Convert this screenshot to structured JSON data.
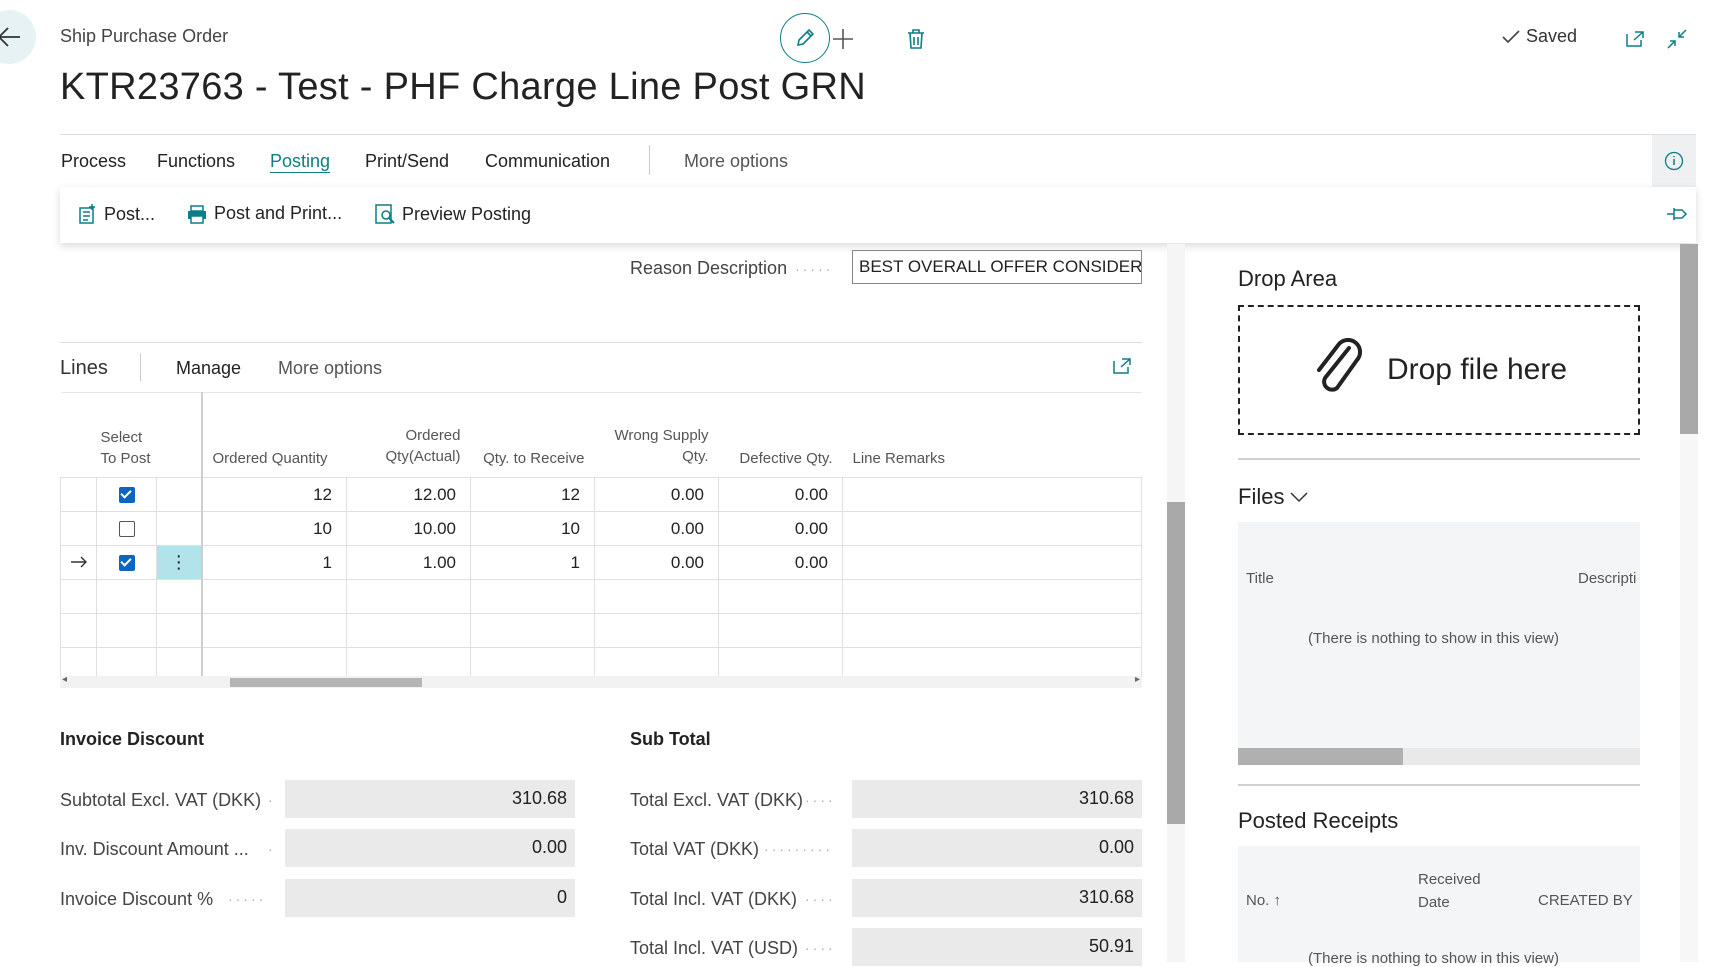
{
  "header": {
    "breadcrumb": "Ship Purchase Order",
    "title": "KTR23763 - Test - PHF Charge Line Post GRN",
    "saved_label": "Saved"
  },
  "menu": {
    "items": [
      "Process",
      "Functions",
      "Posting",
      "Print/Send",
      "Communication"
    ],
    "active": "Posting",
    "more": "More options"
  },
  "actions": {
    "post": "Post...",
    "post_print": "Post and Print...",
    "preview": "Preview Posting"
  },
  "reason": {
    "label": "Reason Description",
    "value": "BEST OVERALL OFFER CONSIDERIN"
  },
  "lines": {
    "title": "Lines",
    "manage": "Manage",
    "more": "More options",
    "columns": {
      "select": "Select To Post",
      "ordered_qty": "Ordered Quantity",
      "ordered_actual": "Ordered Qty(Actual)",
      "qty_receive": "Qty. to Receive",
      "wrong_supply": "Wrong Supply Qty.",
      "defective": "Defective Qty.",
      "remarks": "Line Remarks"
    },
    "rows": [
      {
        "selected": true,
        "ordered_qty": "12",
        "ordered_actual": "12.00",
        "qty_receive": "12",
        "wrong_supply": "0.00",
        "defective": "0.00",
        "remarks": ""
      },
      {
        "selected": false,
        "ordered_qty": "10",
        "ordered_actual": "10.00",
        "qty_receive": "10",
        "wrong_supply": "0.00",
        "defective": "0.00",
        "remarks": ""
      },
      {
        "selected": true,
        "ordered_qty": "1",
        "ordered_actual": "1.00",
        "qty_receive": "1",
        "wrong_supply": "0.00",
        "defective": "0.00",
        "remarks": ""
      }
    ]
  },
  "invoice_discount": {
    "title": "Invoice Discount",
    "subtotal_label": "Subtotal Excl. VAT (DKK)",
    "subtotal_value": "310.68",
    "amount_label": "Inv. Discount Amount ...",
    "amount_value": "0.00",
    "percent_label": "Invoice Discount %",
    "percent_value": "0"
  },
  "sub_total": {
    "title": "Sub Total",
    "excl_label": "Total Excl. VAT (DKK)",
    "excl_value": "310.68",
    "vat_label": "Total VAT (DKK)",
    "vat_value": "0.00",
    "incl_label": "Total Incl. VAT (DKK)",
    "incl_value": "310.68",
    "usd_label": "Total Incl. VAT (USD)",
    "usd_value": "50.91"
  },
  "side": {
    "drop_title": "Drop Area",
    "drop_text": "Drop file here",
    "files_title": "Files",
    "files_col_title": "Title",
    "files_col_desc": "Descripti",
    "files_empty": "(There is nothing to show in this view)",
    "receipts_title": "Posted Receipts",
    "receipts_col_no": "No. ↑",
    "receipts_col_date": "Received Date",
    "receipts_col_created": "CREATED BY",
    "receipts_empty": "(There is nothing to show in this view)"
  },
  "colors": {
    "accent": "#0b7e86",
    "checkbox": "#0b66c3",
    "selected_cell": "#b3e3ea"
  }
}
